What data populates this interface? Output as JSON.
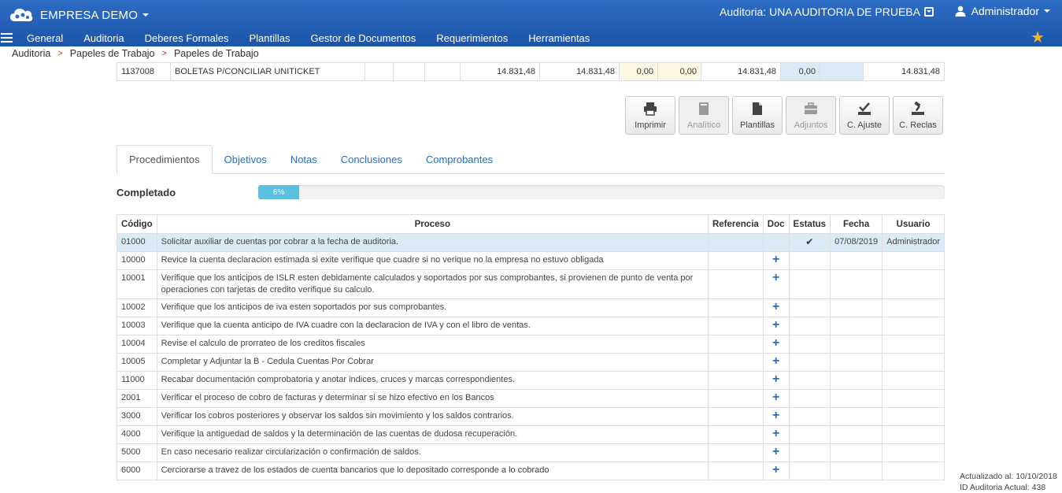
{
  "header": {
    "company": "EMPRESA DEMO",
    "audit": "Auditoria: UNA AUDITORIA DE PRUEBA",
    "user": "Administrador"
  },
  "nav": [
    "General",
    "Auditoria",
    "Deberes Formales",
    "Plantillas",
    "Gestor de Documentos",
    "Requerimientos",
    "Herramientas"
  ],
  "breadcrumb": [
    "Auditoria",
    "Papeles de Trabajo",
    "Papeles de Trabajo"
  ],
  "top_row": {
    "code": "1137008",
    "desc": "BOLETAS P/CONCILIAR UNITICKET",
    "v1": "14.831,48",
    "v2": "14.831,48",
    "v3": "0,00",
    "v4": "0,00",
    "v5": "14.831,48",
    "v6": "0,00",
    "v7": "14.831,48"
  },
  "actions": [
    {
      "label": "Imprimir",
      "icon": "print-icon",
      "enabled": true
    },
    {
      "label": "Analítico",
      "icon": "book-icon",
      "enabled": false
    },
    {
      "label": "Plantillas",
      "icon": "file-icon",
      "enabled": true
    },
    {
      "label": "Adjuntos",
      "icon": "briefcase-icon",
      "enabled": false
    },
    {
      "label": "C. Ajuste",
      "icon": "check-tray-icon",
      "enabled": true
    },
    {
      "label": "C. Reclas",
      "icon": "hammer-tray-icon",
      "enabled": true
    }
  ],
  "tabs": [
    "Procedimientos",
    "Objetivos",
    "Notas",
    "Conclusiones",
    "Comprobantes"
  ],
  "progress": {
    "label": "Completado",
    "percent": 6,
    "text": "6%"
  },
  "table": {
    "headers": [
      "Código",
      "Proceso",
      "Referencia",
      "Doc",
      "Estatus",
      "Fecha",
      "Usuario"
    ],
    "rows": [
      {
        "code": "01000",
        "proceso": "Solicitar auxiliar de cuentas por cobrar a la fecha de auditoria.",
        "status": "✔",
        "fecha": "07/08/2019",
        "usuario": "Administrador",
        "highlight": true
      },
      {
        "code": "10000",
        "proceso": "Revice la cuenta declaracion estimada si exite verifique que cuadre si no verique no la empresa no estuvo obligada",
        "doc": "+"
      },
      {
        "code": "10001",
        "proceso": "Verifique que los anticipos de ISLR esten debidamente calculados y soportados por sus comprobantes, si provienen de punto de venta por operaciones con tarjetas de credito verifique su calculo.",
        "doc": "+"
      },
      {
        "code": "10002",
        "proceso": "Verifique que los anticipos de iva esten soportados por sus comprobantes.",
        "doc": "+"
      },
      {
        "code": "10003",
        "proceso": "Verifique que la cuenta anticipo de IVA cuadre con la declaracion de IVA y con el libro de ventas.",
        "doc": "+"
      },
      {
        "code": "10004",
        "proceso": "Revise el calculo de prorrateo de los creditos fiscales",
        "doc": "+"
      },
      {
        "code": "10005",
        "proceso": "Completar y Adjuntar la B - Cedula Cuentas Por Cobrar",
        "doc": "+"
      },
      {
        "code": "11000",
        "proceso": "Recabar documentación comprobatoria y anotar indices, cruces y marcas correspondientes.",
        "doc": "+"
      },
      {
        "code": "2001",
        "proceso": "Verificar el proceso de cobro de facturas y determinar si se hizo efectivo en los Bancos",
        "doc": "+"
      },
      {
        "code": "3000",
        "proceso": "Verificar los cobros posteriores y observar los saldos sin movimiento y los saldos contrarios.",
        "doc": "+"
      },
      {
        "code": "4000",
        "proceso": "Verifique la antiguedad de saldos y la determinación de las cuentas de dudosa recuperación.",
        "doc": "+"
      },
      {
        "code": "5000",
        "proceso": "En caso necesario realizar circularización o confirmación de saldos.",
        "doc": "+"
      },
      {
        "code": "6000",
        "proceso": "Cerciorarse a travez de los estados de cuenta bancarios que lo depositado corresponde a lo cobrado",
        "doc": "+"
      }
    ]
  },
  "footer": {
    "updated": "Actualizado al: 10/10/2018",
    "audit_id": "ID Auditoria Actual: 438"
  }
}
